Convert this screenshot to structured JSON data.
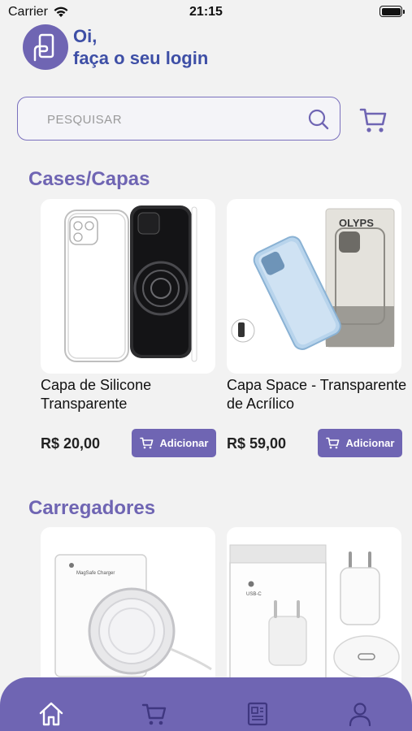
{
  "status_bar": {
    "carrier": "Carrier",
    "time": "21:15"
  },
  "header": {
    "greeting_line1": "Oi,",
    "greeting_line2": "faça o seu login"
  },
  "search": {
    "placeholder": "PESQUISAR"
  },
  "sections": [
    {
      "title": "Cases/Capas",
      "products": [
        {
          "name": "Capa de Silicone Transparente",
          "price": "R$ 20,00",
          "button_label": "Adicionar"
        },
        {
          "name": "Capa Space - Transparente de Acrílico",
          "price": "R$ 59,00",
          "button_label": "Adicionar"
        }
      ]
    },
    {
      "title": "Carregadores",
      "products": [
        {
          "box_label": "MagSafe Charger"
        },
        {
          "box_label": "USB-C"
        }
      ]
    }
  ],
  "product_box_brand": "OLYPS",
  "nav": {
    "items": [
      "home-icon",
      "cart-icon",
      "news-icon",
      "user-icon"
    ],
    "active": "home-icon"
  },
  "colors": {
    "accent": "#6f65b3",
    "greeting": "#3e4fa6",
    "background": "#f2f2f2"
  }
}
